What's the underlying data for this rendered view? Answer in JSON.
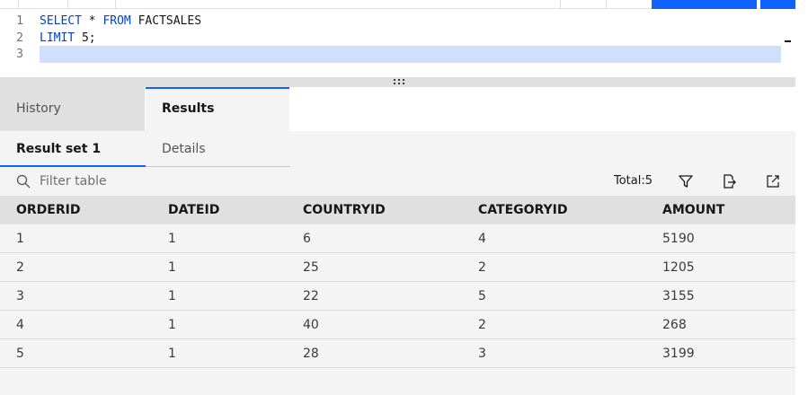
{
  "editor": {
    "lines": [
      {
        "num": "1",
        "tokens": [
          {
            "t": "SELECT",
            "kw": true
          },
          {
            "t": " * ",
            "kw": false
          },
          {
            "t": "FROM",
            "kw": true
          },
          {
            "t": " FACTSALES",
            "kw": false
          }
        ]
      },
      {
        "num": "2",
        "tokens": [
          {
            "t": "LIMIT",
            "kw": true
          },
          {
            "t": " 5;",
            "kw": false
          }
        ]
      },
      {
        "num": "3",
        "tokens": []
      }
    ]
  },
  "tabs": {
    "history_label": "History",
    "results_label": "Results"
  },
  "subtabs": {
    "result_set_label": "Result set 1",
    "details_label": "Details"
  },
  "filter": {
    "placeholder": "Filter table",
    "total_label": "Total:5"
  },
  "icons": {
    "search": "search-icon",
    "filter": "filter-icon",
    "export": "export-icon",
    "open_new": "launch-icon",
    "grip": "drag-handle-icon"
  },
  "colors": {
    "accent": "#0f62fe",
    "keyword": "#0043ce",
    "line_highlight": "#cfe0fc"
  },
  "table": {
    "columns": [
      "ORDERID",
      "DATEID",
      "COUNTRYID",
      "CATEGORYID",
      "AMOUNT"
    ],
    "rows": [
      [
        "1",
        "1",
        "6",
        "4",
        "5190"
      ],
      [
        "2",
        "1",
        "25",
        "2",
        "1205"
      ],
      [
        "3",
        "1",
        "22",
        "5",
        "3155"
      ],
      [
        "4",
        "1",
        "40",
        "2",
        "268"
      ],
      [
        "5",
        "1",
        "28",
        "3",
        "3199"
      ]
    ]
  }
}
